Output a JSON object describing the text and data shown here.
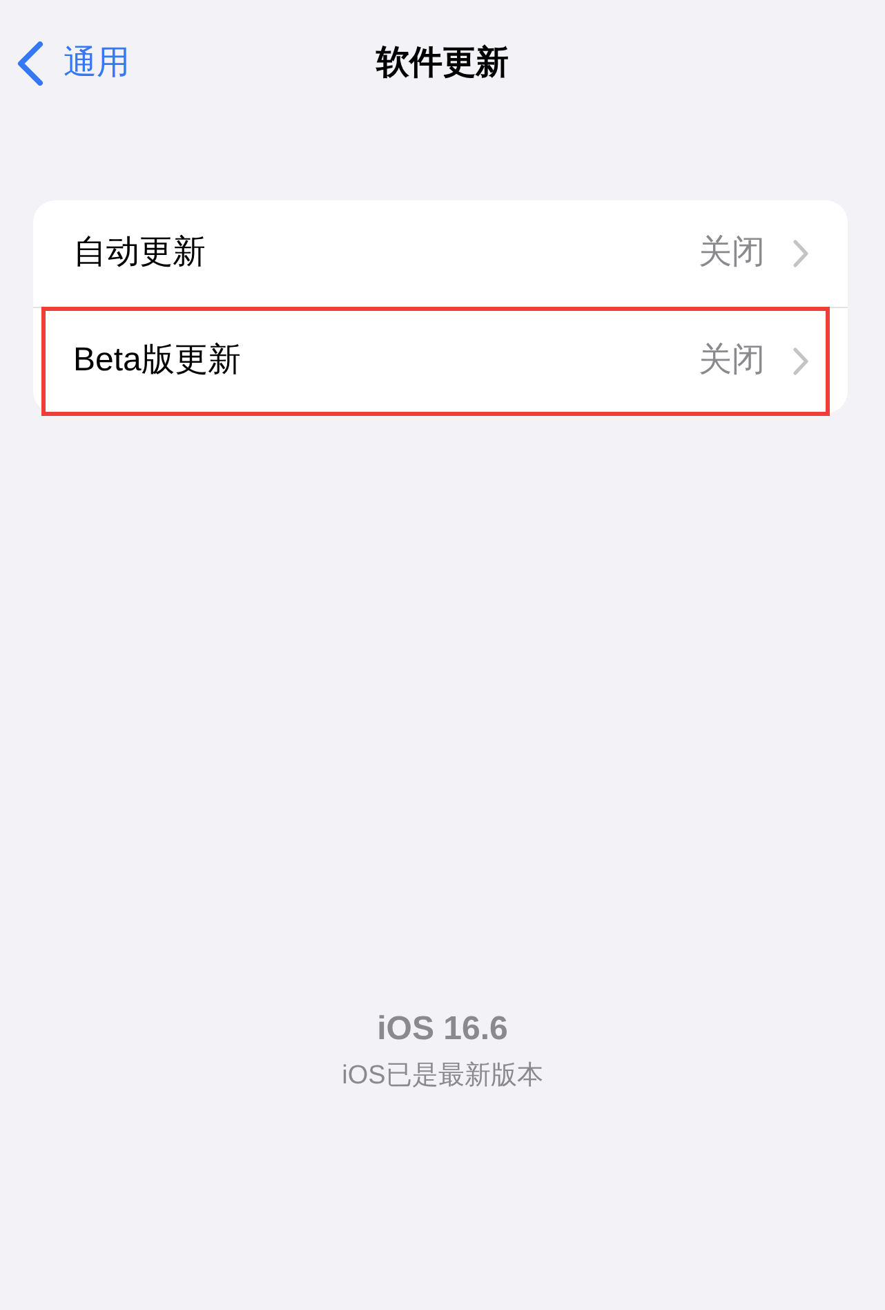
{
  "nav": {
    "back_label": "通用",
    "title": "软件更新"
  },
  "settings": [
    {
      "label": "自动更新",
      "value": "关闭",
      "highlighted": false
    },
    {
      "label": "Beta版更新",
      "value": "关闭",
      "highlighted": true
    }
  ],
  "footer": {
    "version": "iOS 16.6",
    "status": "iOS已是最新版本"
  }
}
